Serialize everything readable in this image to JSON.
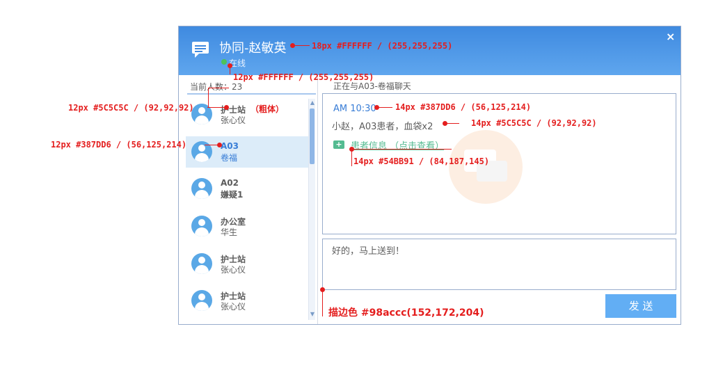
{
  "window": {
    "title": "协同-赵敏英",
    "status": "在线",
    "close_icon": "×",
    "accent_color": "#3f8ae0"
  },
  "sidebar": {
    "online_count": "当前人数：23",
    "contacts": [
      {
        "name": "护士站",
        "sub": "张心仪",
        "active": false
      },
      {
        "name": "A03",
        "sub": "卷福",
        "active": true
      },
      {
        "name": "A02",
        "sub": "嫌疑1",
        "active": false
      },
      {
        "name": "办公室",
        "sub": "华生",
        "active": false
      },
      {
        "name": "护士站",
        "sub": "张心仪",
        "active": false
      },
      {
        "name": "护士站",
        "sub": "张心仪",
        "active": false
      }
    ]
  },
  "chat": {
    "with_label": "正在与A03-卷福聊天",
    "message_time": "AM 10:30",
    "message_text": "小赵，A03患者，血袋x2",
    "patient_link": "患者信息 （点击查看）",
    "input_value": "好的，马上送到！",
    "send_label": "发 送"
  },
  "annotations": {
    "title_spec": "18px #FFFFFF / (255,255,255)",
    "status_spec": "12px #FFFFFF / (255,255,255)",
    "contact_name_spec": "12px #5C5C5C / (92,92,92)",
    "contact_name_bold": "（粗体）",
    "active_spec": "12px #387DD6 / (56,125,214)",
    "time_spec": "14px #387DD6 / (56,125,214)",
    "msg_spec": "14px #5C5C5C / (92,92,92)",
    "link_spec": "14px #54BB91 / (84,187,145)",
    "border_spec": "描边色 #98accc(152,172,204)"
  },
  "colors": {
    "annotation": "#e41e1e",
    "border": "#98accc",
    "text": "#5c5c5c",
    "active_text": "#387dd6",
    "link": "#54bb91"
  }
}
